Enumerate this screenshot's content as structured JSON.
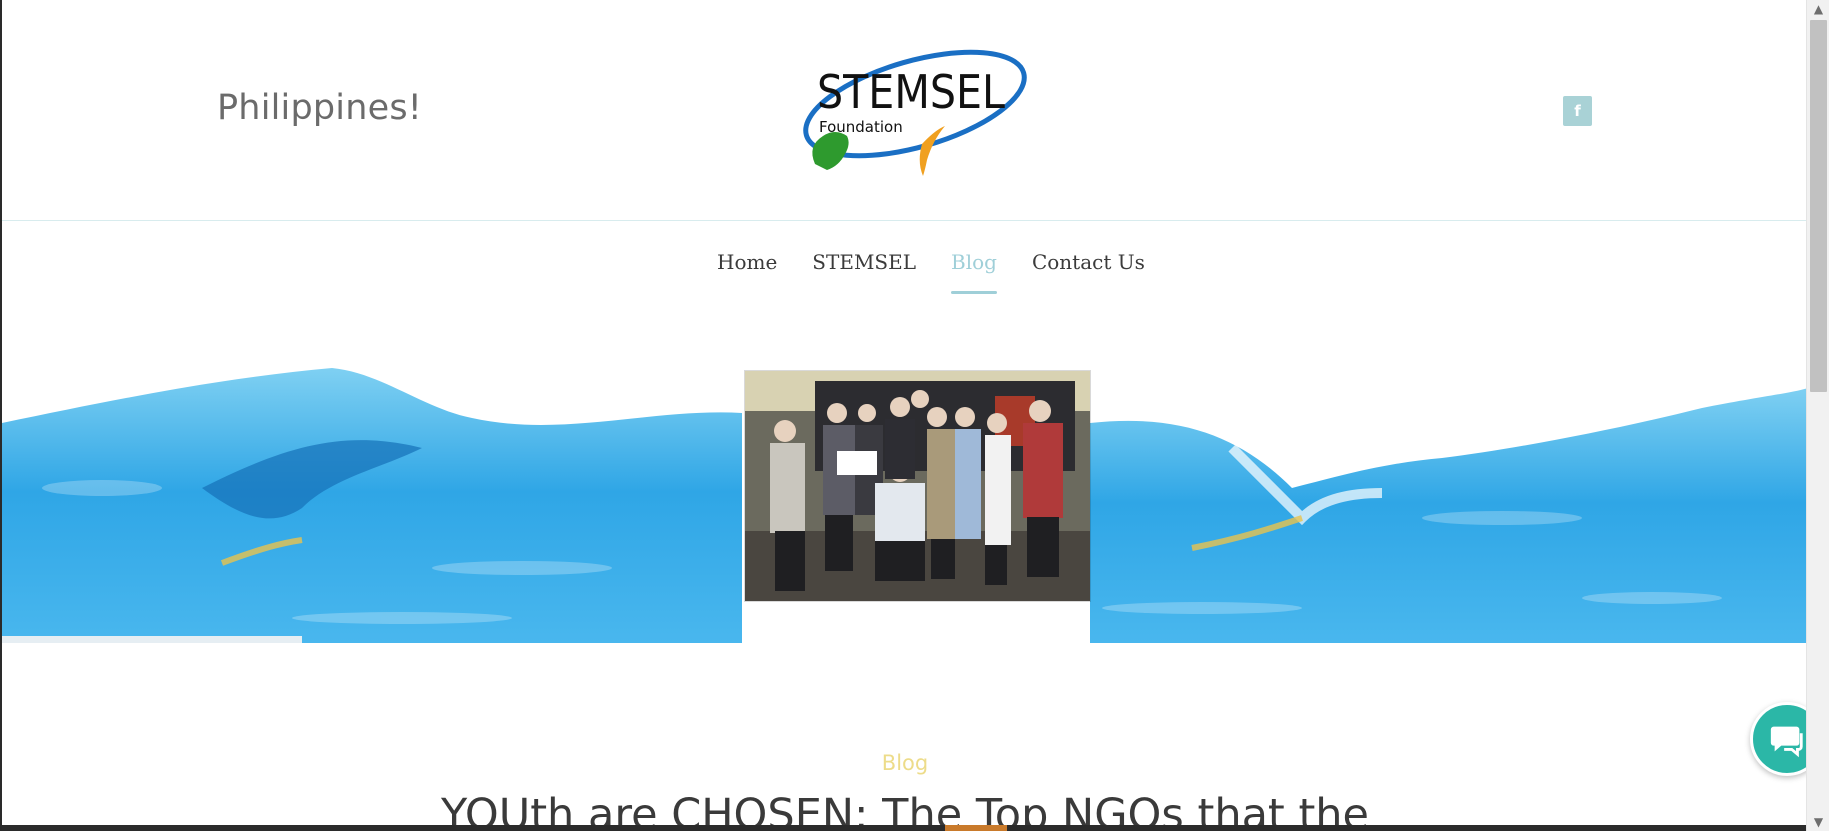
{
  "header": {
    "tagline": "Philippines!",
    "logo": {
      "brand": "STEMSEL",
      "sub": "Foundation",
      "colors": {
        "ring": "#1a6fc4",
        "australia": "#2e9a2e",
        "boomerang": "#f0a020"
      }
    },
    "social": {
      "icon": "facebook-icon",
      "glyph": "f",
      "color": "#a9d2d6"
    }
  },
  "nav": {
    "items": [
      {
        "label": "Home",
        "active": false
      },
      {
        "label": "STEMSEL",
        "active": false
      },
      {
        "label": "Blog",
        "active": true
      },
      {
        "label": "Contact Us",
        "active": false
      }
    ],
    "active_color": "#9fcfd8"
  },
  "hero": {
    "background": "blue-wave-microscopy-image",
    "photo": "group-photo-award-certificate"
  },
  "post": {
    "category": "Blog",
    "title": "YOUth are CHOSEN: The Top NGOs that the"
  },
  "chat": {
    "icon": "chat-bubble-icon",
    "color": "#2bb7a7"
  },
  "scrollbar": {
    "up": "▲",
    "down": "▼"
  }
}
